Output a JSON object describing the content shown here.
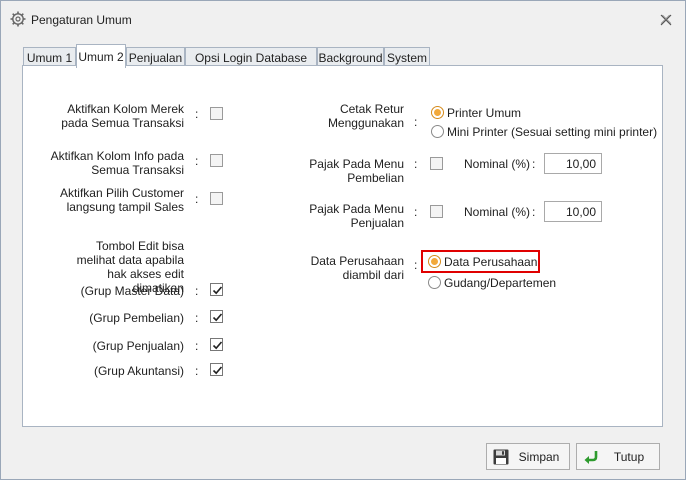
{
  "window": {
    "title": "Pengaturan Umum"
  },
  "tabs": [
    "Umum 1",
    "Umum 2",
    "Penjualan",
    "Opsi Login Database",
    "Background",
    "System"
  ],
  "active_tab": "Umum 2",
  "left": {
    "merek_label": "Aktifkan Kolom Merek pada Semua Transaksi",
    "info_label": "Aktifkan Kolom Info pada Semua Transaksi",
    "customer_label": "Aktifkan Pilih Customer langsung tampil Sales",
    "edit_label": "Tombol Edit bisa melihat data apabila hak akses edit dimatikan",
    "groups": [
      "(Grup Master Data)",
      "(Grup Pembelian)",
      "(Grup Penjualan)",
      "(Grup Akuntansi)"
    ]
  },
  "colon": ":",
  "right": {
    "cetak_label": "Cetak Retur Menggunakan",
    "cetak_options": [
      "Printer Umum",
      "Mini Printer (Sesuai setting mini printer)"
    ],
    "pajak_beli_label": "Pajak Pada Menu Pembelian",
    "pajak_jual_label": "Pajak Pada Menu Penjualan",
    "nominal_label": "Nominal (%)",
    "nominal_beli_value": "10,00",
    "nominal_jual_value": "10,00",
    "data_label": "Data Perusahaan diambil dari",
    "data_options": [
      "Data Perusahaan",
      "Gudang/Departemen"
    ]
  },
  "buttons": {
    "save": "Simpan",
    "close": "Tutup"
  },
  "colors": {
    "highlight": "#e00000",
    "radio_selected": "#f2a93b",
    "panel_border": "#a9b4c2"
  },
  "icons": [
    "gear-icon",
    "close-icon",
    "floppy-disk-icon",
    "return-arrow-icon",
    "checkmark-icon"
  ]
}
